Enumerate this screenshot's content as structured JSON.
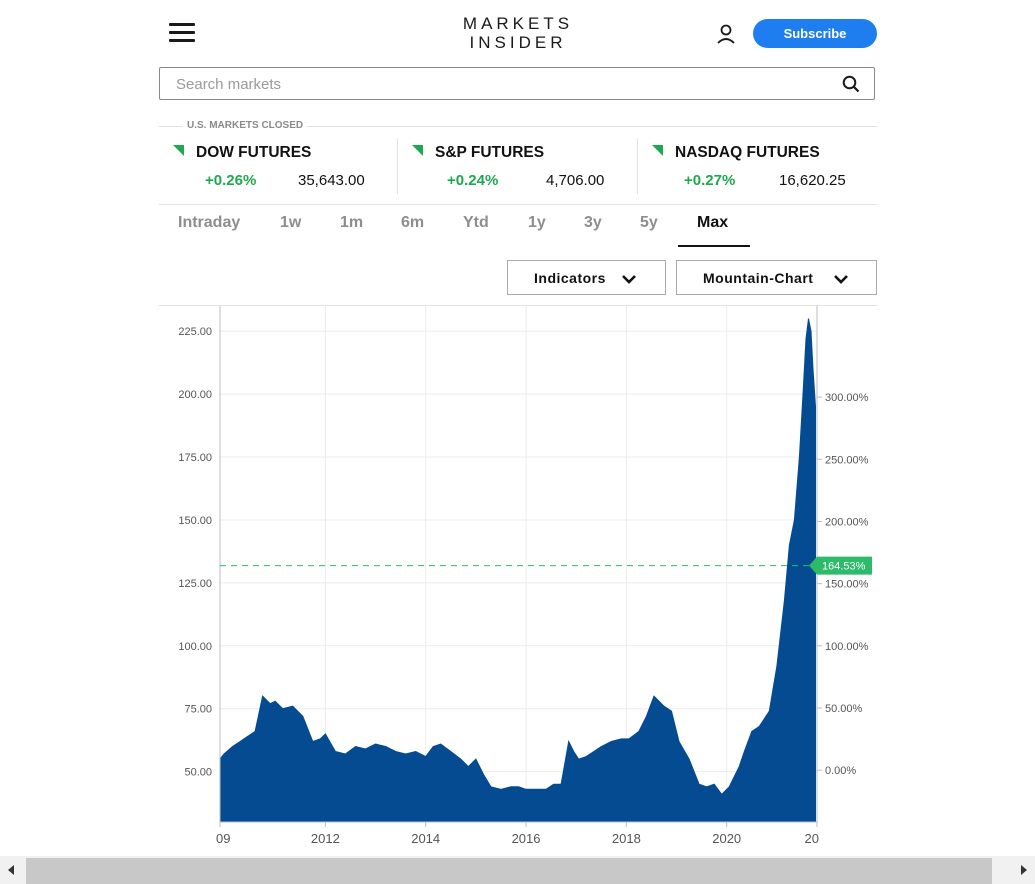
{
  "header": {
    "logo_line1": "MARKETS",
    "logo_line2": "INSIDER",
    "subscribe_label": "Subscribe"
  },
  "search": {
    "placeholder": "Search markets",
    "value": ""
  },
  "market_status": "U.S. MARKETS CLOSED",
  "futures": [
    {
      "name": "DOW FUTURES",
      "change": "+0.26%",
      "value": "35,643.00",
      "direction": "up"
    },
    {
      "name": "S&P FUTURES",
      "change": "+0.24%",
      "value": "4,706.00",
      "direction": "up"
    },
    {
      "name": "NASDAQ FUTURES",
      "change": "+0.27%",
      "value": "16,620.25",
      "direction": "up"
    }
  ],
  "tabs": [
    {
      "label": "Intraday"
    },
    {
      "label": "1w"
    },
    {
      "label": "1m"
    },
    {
      "label": "6m"
    },
    {
      "label": "Ytd"
    },
    {
      "label": "1y"
    },
    {
      "label": "3y"
    },
    {
      "label": "5y"
    },
    {
      "label": "Max",
      "active": true
    }
  ],
  "controls": {
    "indicators_label": "Indicators",
    "chart_type_label": "Mountain-Chart"
  },
  "colors": {
    "accent": "#1e7ef0",
    "positive": "#1fa84f",
    "area": "#054b92",
    "current_line": "#2dba6a"
  },
  "chart_data": {
    "type": "area",
    "left_axis": {
      "ticks": [
        "225.00",
        "200.00",
        "175.00",
        "150.00",
        "125.00",
        "100.00",
        "75.00",
        "50.00"
      ],
      "values": [
        225,
        200,
        175,
        150,
        125,
        100,
        75,
        50
      ],
      "ylim": [
        30,
        235
      ]
    },
    "right_axis": {
      "ticks": [
        "300.00%",
        "250.00%",
        "200.00%",
        "150.00%",
        "100.00%",
        "50.00%",
        "0.00%"
      ],
      "values": [
        300,
        250,
        200,
        150,
        100,
        50,
        0
      ]
    },
    "current_label": "164.53%",
    "current_value": 164.53,
    "x_ticks": [
      "09",
      "2012",
      "2014",
      "2016",
      "2018",
      "2020",
      "20"
    ],
    "x_tick_years": [
      2009.9,
      2012,
      2014,
      2016,
      2018,
      2020,
      2021.8
    ],
    "xlim": [
      2009.9,
      2021.8
    ],
    "x": [
      2009.9,
      2009.98,
      2010.15,
      2010.3,
      2010.45,
      2010.6,
      2010.75,
      2010.9,
      2011.0,
      2011.15,
      2011.35,
      2011.55,
      2011.75,
      2011.9,
      2012.0,
      2012.2,
      2012.4,
      2012.6,
      2012.8,
      2013.0,
      2013.2,
      2013.4,
      2013.6,
      2013.8,
      2014.0,
      2014.15,
      2014.3,
      2014.5,
      2014.7,
      2014.85,
      2015.0,
      2015.15,
      2015.3,
      2015.5,
      2015.7,
      2015.85,
      2016.0,
      2016.2,
      2016.4,
      2016.55,
      2016.7,
      2016.85,
      2016.95,
      2017.05,
      2017.2,
      2017.35,
      2017.5,
      2017.7,
      2017.9,
      2018.05,
      2018.25,
      2018.4,
      2018.55,
      2018.75,
      2018.9,
      2019.05,
      2019.25,
      2019.45,
      2019.6,
      2019.75,
      2019.9,
      2020.05,
      2020.15,
      2020.25,
      2020.35,
      2020.5,
      2020.65,
      2020.85,
      2021.0,
      2021.15,
      2021.25,
      2021.35,
      2021.45,
      2021.52,
      2021.58,
      2021.63,
      2021.68,
      2021.72,
      2021.77
    ],
    "y": [
      55,
      57,
      60,
      62,
      64,
      66,
      80,
      77,
      78,
      75,
      76,
      72,
      62,
      63,
      65,
      58,
      57,
      60,
      59,
      61,
      60,
      58,
      57,
      58,
      56,
      60,
      61,
      58,
      55,
      52,
      55,
      49,
      44,
      43,
      44,
      44,
      43,
      43,
      43,
      45,
      45,
      62,
      58,
      55,
      56,
      58,
      60,
      62,
      63,
      63,
      66,
      72,
      80,
      76,
      74,
      62,
      55,
      45,
      44,
      45,
      41,
      44,
      48,
      52,
      58,
      66,
      68,
      74,
      92,
      118,
      140,
      150,
      175,
      200,
      222,
      230,
      225,
      210,
      195
    ]
  }
}
